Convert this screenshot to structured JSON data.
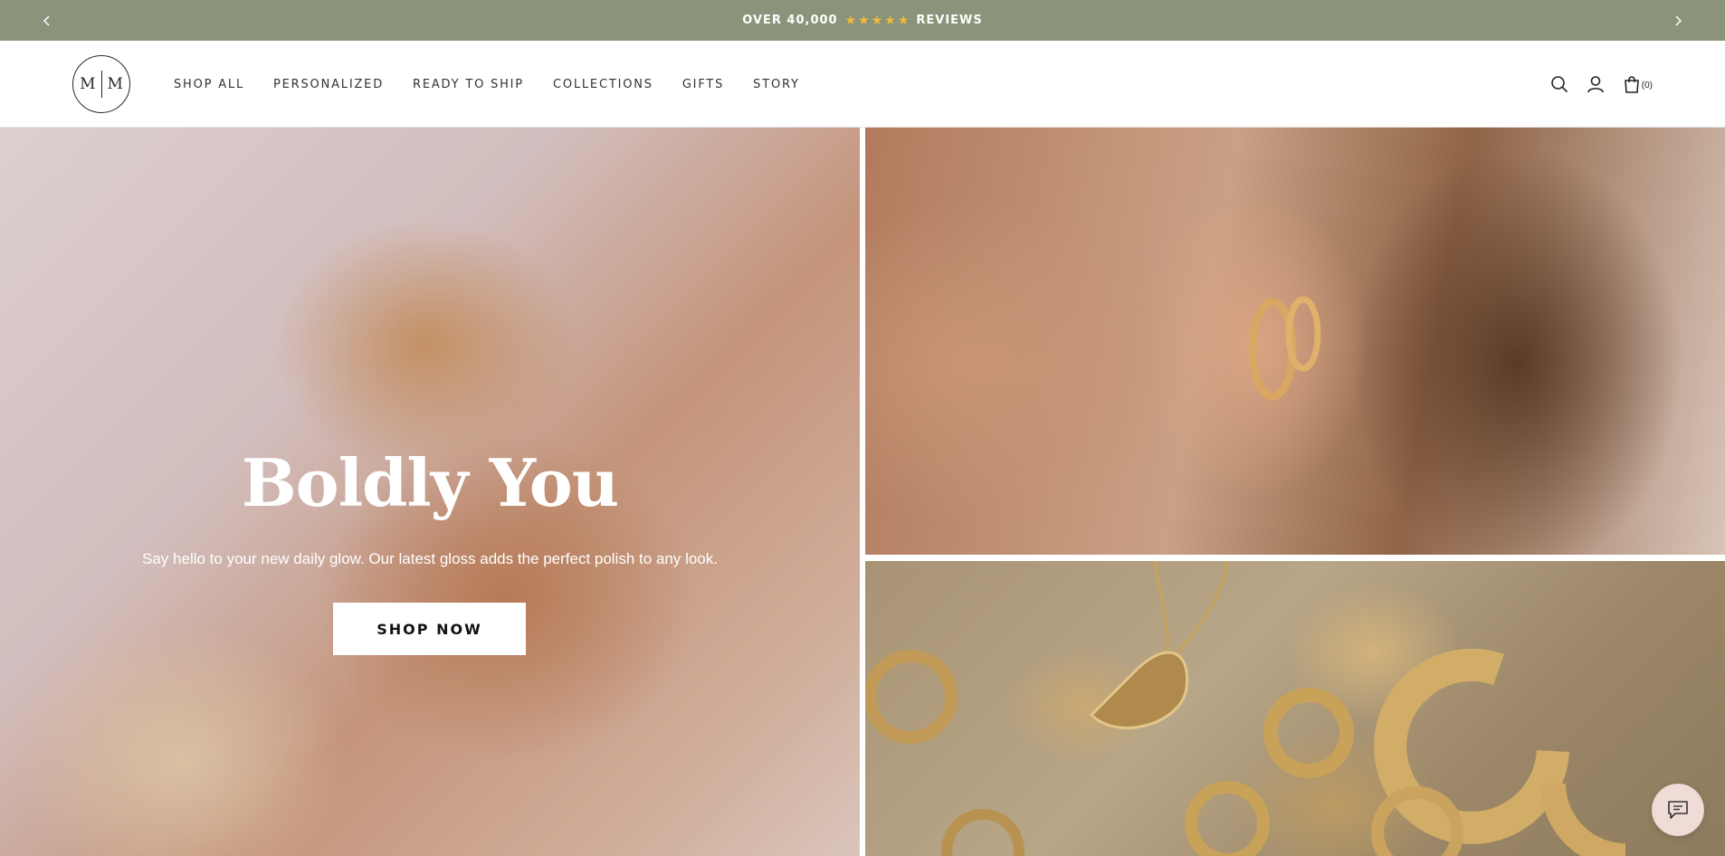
{
  "announcement": {
    "text_before": "OVER 40,000",
    "stars": "★★★★★",
    "text_after": "REVIEWS",
    "prev_icon": "chevron-left-icon",
    "next_icon": "chevron-right-icon"
  },
  "header": {
    "logo": {
      "left": "M",
      "right": "M"
    },
    "nav": [
      {
        "label": "SHOP ALL"
      },
      {
        "label": "PERSONALIZED"
      },
      {
        "label": "READY TO SHIP"
      },
      {
        "label": "COLLECTIONS"
      },
      {
        "label": "GIFTS"
      },
      {
        "label": "STORY"
      }
    ],
    "icons": [
      "search-icon",
      "account-icon",
      "cart-icon"
    ],
    "cart_count": "(0)"
  },
  "hero": {
    "title": "Boldly You",
    "subtitle": "Say hello to your new daily glow. Our latest gloss adds the perfect polish to any look.",
    "button": "SHOP NOW"
  },
  "chat": {
    "icon": "chat-icon"
  },
  "colors": {
    "announcement_bg": "#8a947a",
    "stars": "#f3b93a",
    "text_dark": "#333333",
    "chat_bg": "#f0dcd6"
  }
}
